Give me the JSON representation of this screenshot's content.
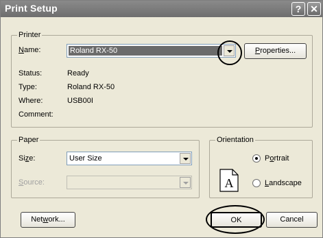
{
  "window": {
    "title": "Print Setup",
    "help_glyph": "?",
    "close_glyph": "✕"
  },
  "printer": {
    "legend": "Printer",
    "name_label_prefix": "N",
    "name_label_rest": "ame:",
    "name_value": "Roland RX-50",
    "properties_prefix": "P",
    "properties_rest": "roperties...",
    "status_label": "Status:",
    "status_value": "Ready",
    "type_label": "Type:",
    "type_value": "Roland RX-50",
    "where_label": "Where:",
    "where_value": "USB00I",
    "comment_label": "Comment:",
    "comment_value": ""
  },
  "paper": {
    "legend": "Paper",
    "size_label_prefix": "Si",
    "size_label_u": "z",
    "size_label_rest": "e:",
    "size_value": "User Size",
    "source_label_prefix": "S",
    "source_label_rest": "ource:",
    "source_value": ""
  },
  "orientation": {
    "legend": "Orientation",
    "icon_letter": "A",
    "portrait_prefix": "P",
    "portrait_u": "o",
    "portrait_rest": "rtrait",
    "landscape_prefix": "L",
    "landscape_rest": "andscape",
    "selected": "portrait"
  },
  "buttons": {
    "network_prefix": "Net",
    "network_u": "w",
    "network_rest": "ork...",
    "ok": "OK",
    "cancel": "Cancel"
  }
}
